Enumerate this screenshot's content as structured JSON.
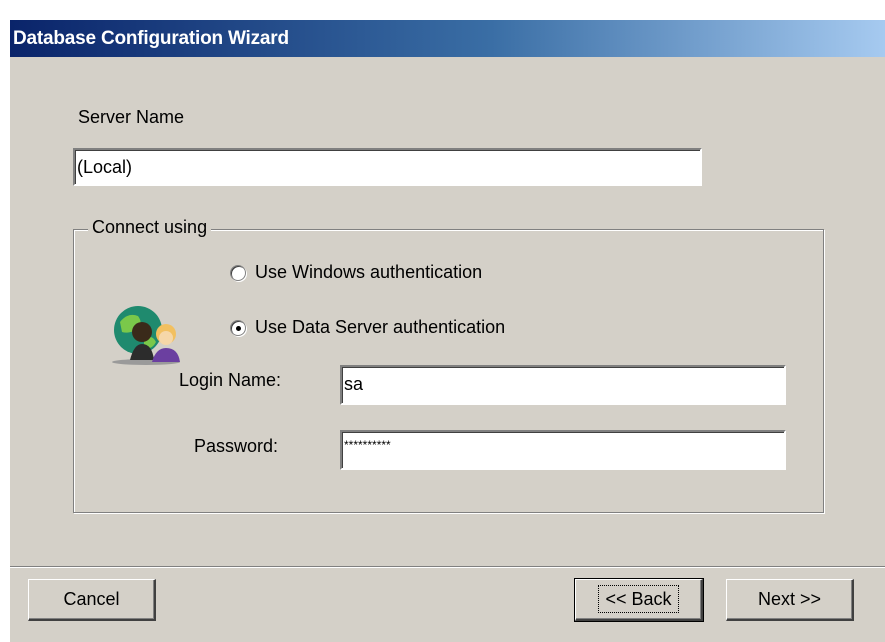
{
  "window": {
    "title": "Database Configuration Wizard"
  },
  "server": {
    "label": "Server Name",
    "value": "(Local)"
  },
  "connect": {
    "legend": "Connect using",
    "options": [
      {
        "label": "Use Windows authentication",
        "selected": false
      },
      {
        "label": "Use Data Server authentication",
        "selected": true
      }
    ],
    "icon": "users-globe-icon"
  },
  "login": {
    "label": "Login Name:",
    "value": "sa"
  },
  "password": {
    "label": "Password:",
    "value": "**********"
  },
  "buttons": {
    "cancel": "Cancel",
    "back": "<< Back",
    "next": "Next >>"
  }
}
